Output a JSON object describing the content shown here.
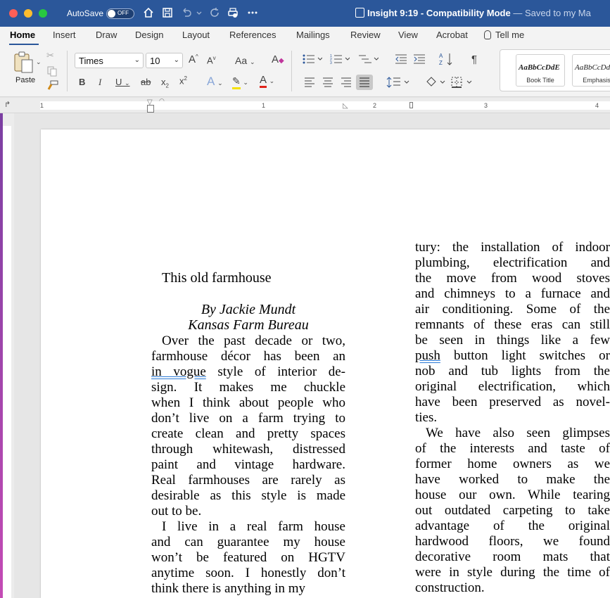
{
  "titlebar": {
    "autosave_label": "AutoSave",
    "toggle_state": "OFF",
    "doc_name": "Insight 9:19",
    "separator": " - ",
    "mode": "Compatibility Mode",
    "saved_status": "— Saved to my Ma"
  },
  "menu": {
    "items": [
      "Home",
      "Insert",
      "Draw",
      "Design",
      "Layout",
      "References",
      "Mailings",
      "Review",
      "View",
      "Acrobat",
      "Tell me"
    ],
    "active": "Home"
  },
  "ribbon": {
    "paste_label": "Paste",
    "font_name": "Times",
    "font_size": "10",
    "styles": [
      {
        "preview": "AaBbCcDdE",
        "name": "Book Title"
      },
      {
        "preview": "AaBbCcDd",
        "name": "Emphasis"
      }
    ]
  },
  "ruler": {
    "numbers": [
      "1",
      "1",
      "2",
      "3",
      "4"
    ]
  },
  "document": {
    "heading": "This old farmhouse",
    "byline_author": "By Jackie Mundt",
    "byline_org": "Kansas Farm Bureau",
    "left_column": [
      "Over the past decade or two,",
      "farmhouse décor has been an",
      "in vogue style of interior de-",
      "sign. It makes me chuckle",
      "when I think about people who",
      "don’t live on a farm trying to",
      "create clean and pretty spaces",
      "through whitewash, distressed",
      "paint and vintage hardware.",
      "Real farmhouses are rarely as",
      "desirable as this style is made",
      "out to be.",
      "I live in a real farm house",
      "and can guarantee my house",
      "won’t be featured on HGTV",
      "anytime soon. I honestly don’t",
      "think there is anything in my"
    ],
    "right_column": [
      "tury: the installation of indoor",
      "plumbing, electrification and",
      "the move from wood stoves",
      "and chimneys to a furnace and",
      "air conditioning. Some of the",
      "remnants of these eras can still",
      "be seen in things like a few",
      "push button light switches or",
      "nob and tub lights from the",
      "original electrification, which",
      "have been preserved as novel-",
      "ties.",
      "We have also seen glimpses",
      "of the interests and taste of",
      "former home owners as we",
      "have worked to make the",
      "house our own. While tearing",
      "out outdated carpeting to take",
      "advantage of the original",
      "hardwood floors, we found",
      "decorative room mats that",
      "were in style during the time of",
      "construction."
    ]
  }
}
